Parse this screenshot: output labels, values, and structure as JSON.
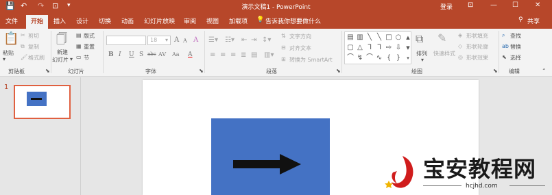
{
  "window": {
    "title": "演示文稿1  -  PowerPoint",
    "login_label": "登录",
    "controls": {
      "ribbon_options": "⊡",
      "minimize": "—",
      "maximize": "☐",
      "close": "✕"
    }
  },
  "quick_access": {
    "save": "💾",
    "undo": "↶",
    "redo": "↷",
    "customize": "▾"
  },
  "tabs": [
    "文件",
    "开始",
    "插入",
    "设计",
    "切换",
    "动画",
    "幻灯片放映",
    "审阅",
    "视图",
    "加载项"
  ],
  "active_tab": "开始",
  "tell_me": "告诉我你想要做什么",
  "share_label": "共享",
  "ribbon": {
    "clipboard": {
      "paste": "粘贴",
      "cut": "剪切",
      "copy": "复制",
      "format_painter": "格式刷",
      "group": "剪贴板"
    },
    "slides": {
      "new_slide_line1": "新建",
      "new_slide_line2": "幻灯片",
      "layout": "版式",
      "reset": "重置",
      "section": "节",
      "group": "幻灯片"
    },
    "font": {
      "font_name": "",
      "font_size": "18",
      "grow": "A",
      "shrink": "A",
      "clear": "A",
      "bold": "B",
      "italic": "I",
      "underline": "U",
      "strike": "S",
      "shadow": "abc",
      "spacing": "AV",
      "change_case": "Aa",
      "color": "A",
      "group": "字体"
    },
    "paragraph": {
      "text_direction": "文字方向",
      "align_text": "对齐文本",
      "smartart": "转换为 SmartArt",
      "group": "段落"
    },
    "drawing": {
      "arrange": "排列",
      "quick_styles": "快速样式",
      "shape_fill": "形状填充",
      "shape_outline": "形状轮廓",
      "shape_effects": "形状效果",
      "group": "绘图"
    },
    "editing": {
      "find": "查找",
      "replace": "替换",
      "select": "选择",
      "group": "编辑"
    }
  },
  "thumbnail": {
    "number": "1"
  },
  "watermark": {
    "text": "宝安教程网",
    "url": "hcjhd.com"
  }
}
